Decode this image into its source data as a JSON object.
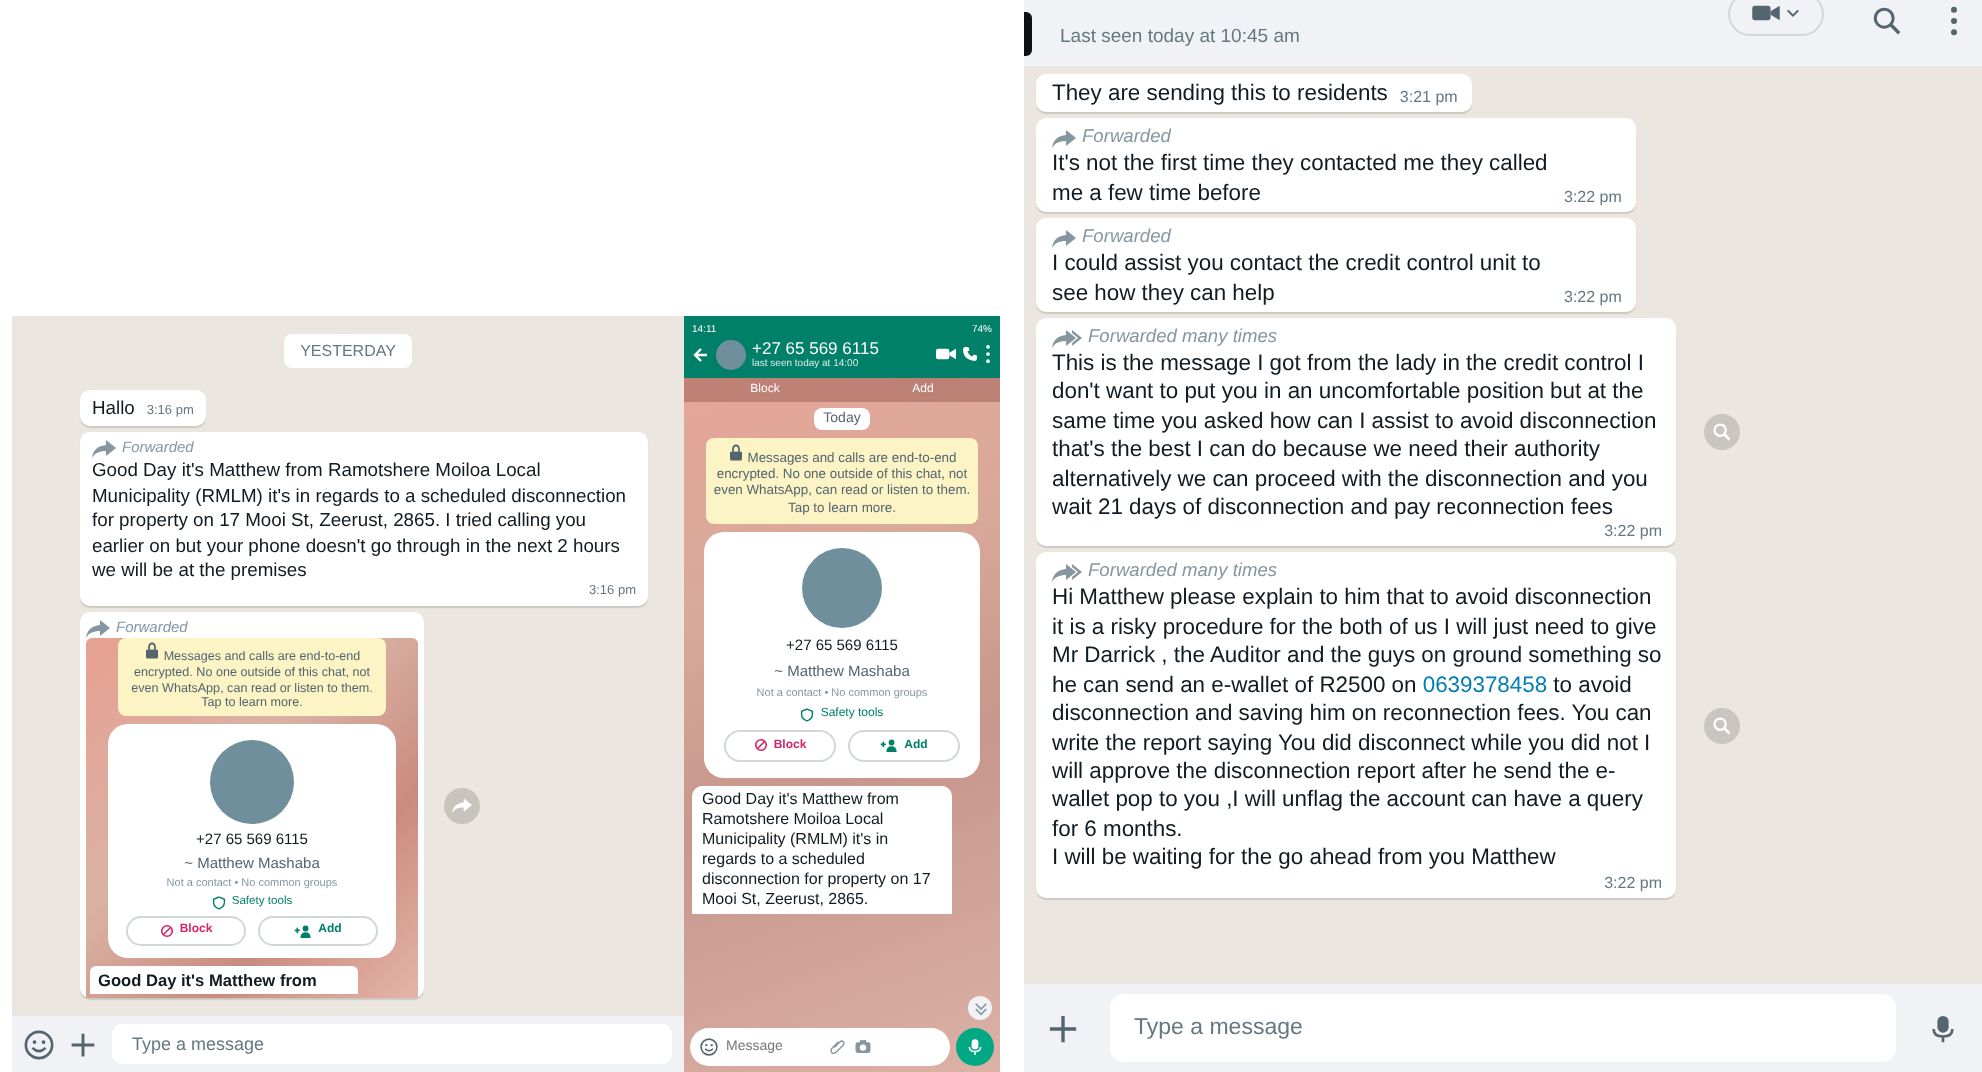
{
  "chat_left": {
    "date_chip": "YESTERDAY",
    "messages": [
      {
        "kind": "text",
        "text": "Hallo",
        "time": "3:16 pm"
      },
      {
        "kind": "text",
        "forward": {
          "kind": "once",
          "label": "Forwarded"
        },
        "text": "Good Day it's Matthew from Ramotshere Moiloa Local Municipality (RMLM) it's in regards to a scheduled disconnection for property on 17 Mooi St, Zeerust, 2865. I tried calling you earlier on but your phone doesn't go through in the next 2 hours we will be at the premises",
        "time": "3:16 pm"
      },
      {
        "kind": "image",
        "forward": {
          "kind": "once",
          "label": "Forwarded"
        },
        "image": {
          "notice": "Messages and calls are end-to-end encrypted. No one outside of this chat, not even WhatsApp, can read or listen to them. Tap to learn more.",
          "contact": {
            "phone": "+27 65 569 6115",
            "name": "~ Matthew Mashaba",
            "info": "Not a contact • No common groups",
            "safety": "Safety tools",
            "block": "Block",
            "add": "Add"
          },
          "caption": "Good Day it's Matthew from"
        }
      }
    ],
    "composer": {
      "placeholder": "Type a message"
    }
  },
  "phone": {
    "status_time": "14:11",
    "battery": "74%",
    "title": "+27 65 569 6115",
    "subtitle": "last seen today at 14:00",
    "banner": [
      "Block",
      "Add"
    ],
    "date_chip": "Today",
    "notice": "Messages and calls are end-to-end encrypted. No one outside of this chat, not even WhatsApp, can read or listen to them. Tap to learn more.",
    "contact": {
      "phone": "+27 65 569 6115",
      "name": "~ Matthew Mashaba",
      "info": "Not a contact • No common groups",
      "safety": "Safety tools",
      "block": "Block",
      "add": "Add"
    },
    "message": "Good Day it's Matthew from Ramotshere Moiloa Local Municipality (RMLM) it's in regards to a scheduled disconnection for property on 17 Mooi St, Zeerust, 2865.",
    "composer": {
      "placeholder": "Message"
    }
  },
  "chat_right": {
    "subtitle": "Last seen today at 10:45 am",
    "messages": [
      {
        "text": "They are sending this to residents",
        "time": "3:21 pm"
      },
      {
        "forward": {
          "kind": "once",
          "label": "Forwarded"
        },
        "text": "It's not the first time they contacted me they called me a few time before",
        "time": "3:22 pm"
      },
      {
        "forward": {
          "kind": "once",
          "label": "Forwarded"
        },
        "text": "I could assist you contact the credit control unit to see how they can help",
        "time": "3:22 pm"
      },
      {
        "forward": {
          "kind": "many",
          "label": "Forwarded many times"
        },
        "text": "This is the message I got from the lady in the credit control I don't want to put you in an uncomfortable position but at the same time you asked how can I assist to avoid disconnection that's the best I can do because we need their authority alternatively we can proceed with the disconnection and you wait 21 days of disconnection and pay reconnection fees",
        "time": "3:22 pm"
      },
      {
        "forward": {
          "kind": "many",
          "label": "Forwarded many times"
        },
        "segments": [
          {
            "kind": "text",
            "text": "Hi Matthew please explain to him that to avoid disconnection it is a risky procedure for the both of us I will just need to give Mr Darrick , the Auditor and the guys on ground something so he can send an e-wallet of R2500  on "
          },
          {
            "kind": "link",
            "text": "0639378458"
          },
          {
            "kind": "text",
            "text": " to avoid disconnection and saving him on reconnection fees. You can write the report saying You did disconnect while you did not I will approve the disconnection report after he send the e-wallet pop to you ,I will unflag the account can have a query for 6 months.\nI will be waiting for the go ahead from you Matthew"
          }
        ],
        "time": "3:22 pm"
      }
    ],
    "composer": {
      "placeholder": "Type a message"
    }
  }
}
